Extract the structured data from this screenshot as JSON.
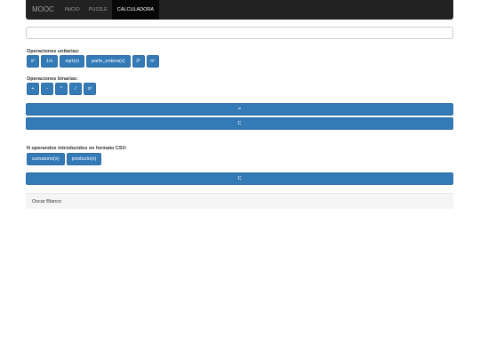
{
  "navbar": {
    "brand": "MOOC",
    "links": [
      "INICIO",
      "PUZZLE",
      "CALCULADORA"
    ],
    "active": "CALCULADORA"
  },
  "display": {
    "value": ""
  },
  "unary": {
    "label": "Operaciones unitarias:",
    "buttons": [
      "x²",
      "1/x",
      "sqrt(x)",
      "parte_entera(x)",
      "2ˣ",
      "n!"
    ]
  },
  "binary": {
    "label": "Operaciones binarias:",
    "buttons": [
      "+",
      "-",
      "*",
      "/",
      "xʸ"
    ]
  },
  "equals_label": "=",
  "clear_label": "C",
  "csv": {
    "label": "N operandos introducidos en formato CSV:",
    "buttons": [
      "sumatorio(x)",
      "producto(x)"
    ],
    "clear_label": "C"
  },
  "footer": {
    "text": "Oscar Blanco"
  },
  "colors": {
    "primary": "#337ab7",
    "navbar": "#222222"
  }
}
